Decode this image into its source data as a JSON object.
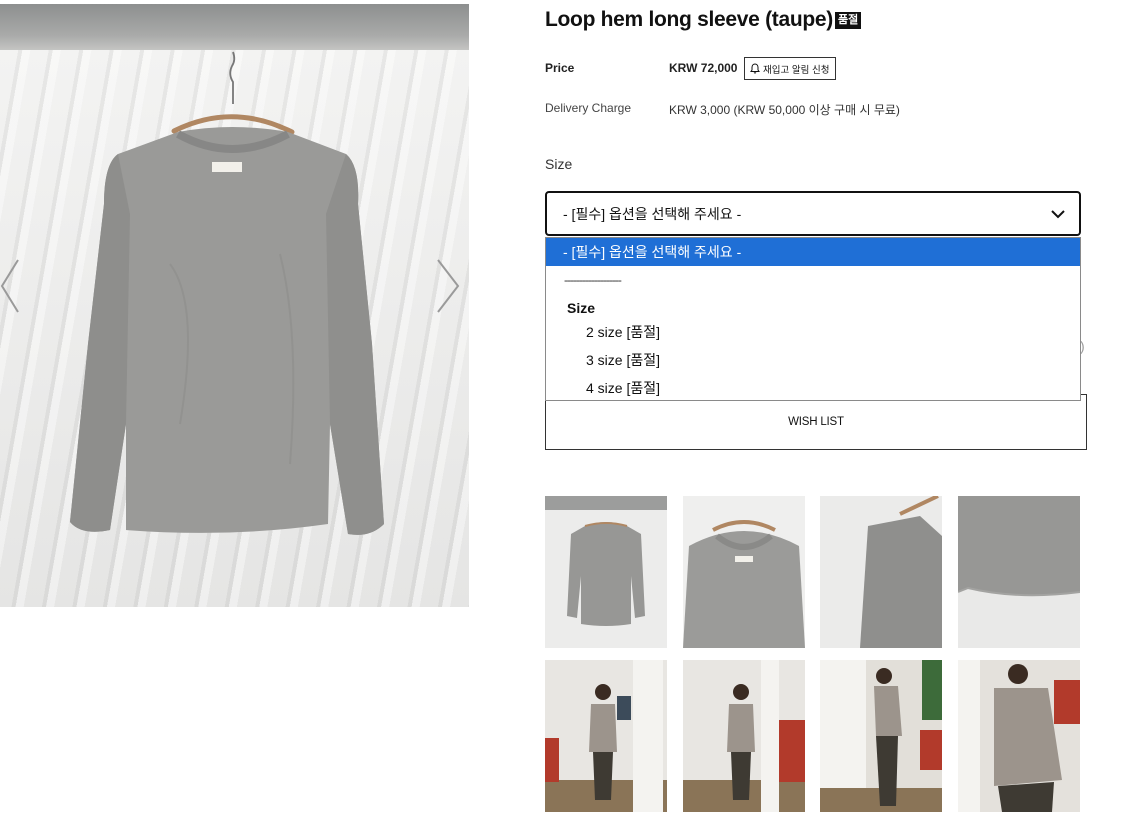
{
  "product": {
    "title": "Loop hem long sleeve (taupe)",
    "soldout_badge": "품절"
  },
  "price": {
    "label": "Price",
    "value": "KRW 72,000",
    "restock_button": "재입고 알림 신청"
  },
  "delivery": {
    "label": "Delivery Charge",
    "value": "KRW 3,000 (KRW 50,000 이상 구매 시 무료)"
  },
  "size_select": {
    "label": "Size",
    "selected": "- [필수] 옵션을 선택해 주세요 -",
    "options": {
      "placeholder": "- [필수] 옵션을 선택해 주세요 -",
      "separator": "-------------------",
      "group_label": "Size",
      "items": [
        "2 size [품절]",
        "3 size [품절]",
        "4 size [품절]"
      ]
    }
  },
  "partially_hidden_text": ")",
  "wishlist_button": "WISH LIST",
  "colors": {
    "selected_option_bg": "#1f6fd6",
    "badge_bg": "#111111"
  }
}
